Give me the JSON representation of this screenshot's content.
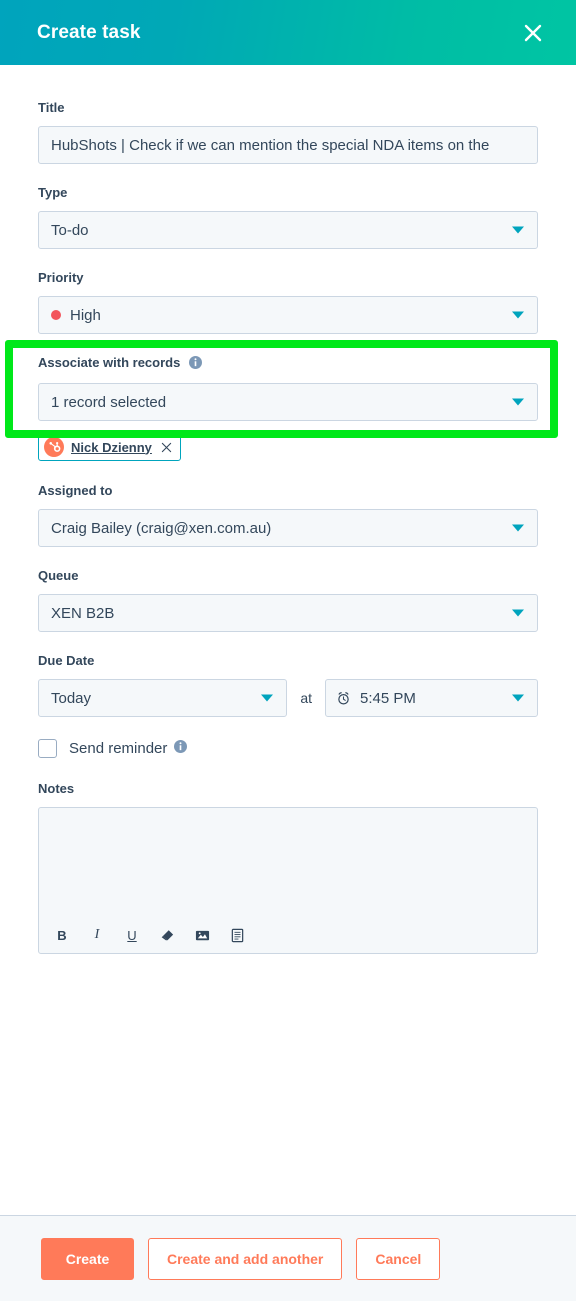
{
  "header": {
    "title": "Create task",
    "close_icon": "close-icon"
  },
  "form": {
    "title_field": {
      "label": "Title",
      "value": "HubShots | Check if we can mention the special NDA items on the",
      "placeholder": "Enter a task title"
    },
    "type_field": {
      "label": "Type",
      "value": "To-do"
    },
    "priority_field": {
      "label": "Priority",
      "value": "High",
      "dot_color": "#F2545B"
    },
    "associate_field": {
      "label": "Associate with records",
      "info_icon": "info-icon",
      "value": "1 record selected",
      "chips": [
        {
          "name": "Nick Dzienny",
          "avatar_icon": "hubspot-sprocket-icon",
          "remove_icon": "close-icon"
        }
      ]
    },
    "assigned_field": {
      "label": "Assigned to",
      "value": "Craig Bailey (craig@xen.com.au)"
    },
    "queue_field": {
      "label": "Queue",
      "value": "XEN B2B"
    },
    "due_date_field": {
      "label": "Due Date",
      "value": "Today",
      "at_text": "at",
      "time_value": "5:45 PM",
      "clock_icon": "alarm-clock-icon"
    },
    "reminder_field": {
      "label": "Send reminder",
      "checked": false,
      "info_icon": "info-icon"
    },
    "notes_field": {
      "label": "Notes",
      "value": "",
      "toolbar": [
        {
          "icon": "bold-icon",
          "label": "B"
        },
        {
          "icon": "italic-icon",
          "label": "I"
        },
        {
          "icon": "underline-icon",
          "label": "U"
        },
        {
          "icon": "eraser-icon",
          "label": ""
        },
        {
          "icon": "image-icon",
          "label": ""
        },
        {
          "icon": "snippet-icon",
          "label": ""
        }
      ]
    }
  },
  "highlight": {
    "target": "priority_field",
    "color": "#00e819"
  },
  "footer": {
    "create_label": "Create",
    "create_add_another_label": "Create and add another",
    "cancel_label": "Cancel"
  },
  "colors": {
    "brand_orange": "#FF7A59",
    "teal": "#00A4BD",
    "green_teal": "#00BDA5",
    "text": "#33475b",
    "field_bg": "#f5f8fa",
    "border": "#cbd6e2"
  }
}
